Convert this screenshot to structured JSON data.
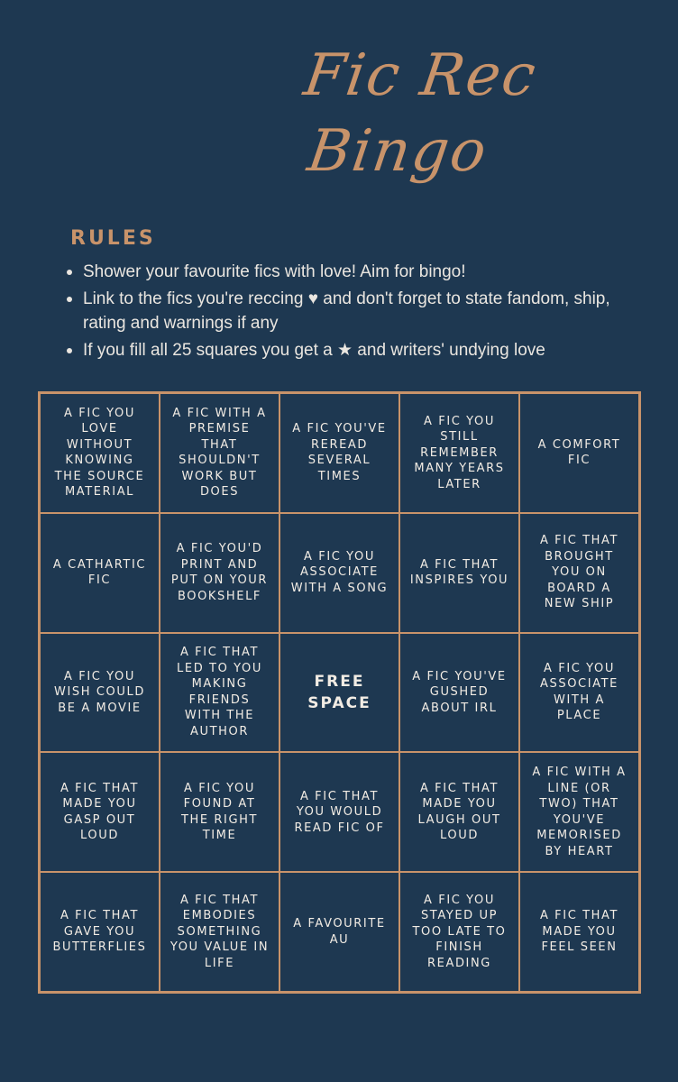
{
  "title": {
    "line1": "Fic Rec",
    "line2": "Bingo"
  },
  "rules": {
    "heading": "RULES",
    "items": [
      "Shower your favourite fics with love! Aim for bingo!",
      "Link to the fics you're reccing ♥ and don't forget to state fandom, ship, rating and warnings if any",
      "If you fill all 25 squares you get a ★ and writers' undying love"
    ]
  },
  "colors": {
    "background": "#1e3851",
    "accent": "#c8936a",
    "text": "#f2ece4"
  },
  "bingo": {
    "cells": [
      "A fic you love without knowing the source material",
      "A fic with a premise that shouldn't work but does",
      "A fic you've reread several times",
      "A fic you still remember many years later",
      "A comfort fic",
      "A cathartic fic",
      "A fic you'd print and put on your bookshelf",
      "A fic you associate with a song",
      "A fic that inspires you",
      "A fic that brought you on board a new ship",
      "A fic you wish could be a movie",
      "A fic that led to you making friends with the author",
      "Free space",
      "A fic you've gushed about IRL",
      "A fic you associate with a place",
      "A fic that made you gasp out loud",
      "A fic you found at the right time",
      "A fic that you would read fic of",
      "A fic that made you laugh out loud",
      "A fic with a line (or two) that you've memorised by heart",
      "A fic that gave you butterflies",
      "A fic that embodies something you value in life",
      "A favourite AU",
      "A fic you stayed up too late to finish reading",
      "A fic that made you feel seen"
    ]
  }
}
